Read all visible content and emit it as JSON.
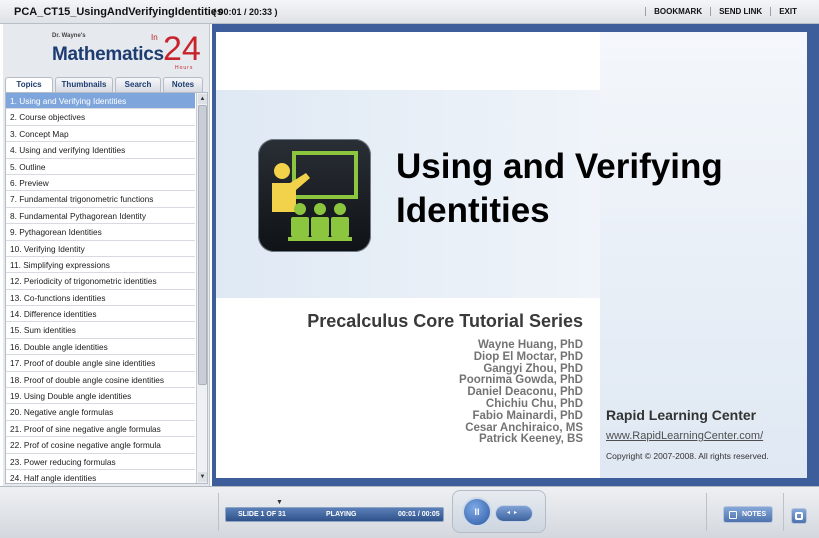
{
  "topbar": {
    "title": "PCA_CT15_UsingAndVerifyingIdentities",
    "time": "( 00:01 / 20:33 )",
    "links": [
      "BOOKMARK",
      "SEND LINK",
      "EXIT"
    ]
  },
  "logo": {
    "byline": "Dr. Wayne's",
    "name": "Mathematics",
    "prefix": "In",
    "number": "24",
    "suffix": "Hours"
  },
  "tabs": [
    "Topics",
    "Thumbnails",
    "Search",
    "Notes"
  ],
  "topics": [
    "1. Using and Verifying Identities",
    "2. Course objectives",
    "3. Concept Map",
    "4. Using and verifying Identities",
    "5. Outline",
    "6. Preview",
    "7. Fundamental trigonometric functions",
    "8.  Fundamental Pythagorean Identity",
    "9. Pythagorean Identities",
    "10. Verifying Identity",
    "11. Simplifying expressions",
    "12. Periodicity of trigonometric identities",
    "13. Co-functions identities",
    "14. Difference identities",
    "15. Sum identities",
    "16. Double angle identities",
    "17. Proof of double angle sine identities",
    "18. Proof of double angle cosine identities",
    "19. Using Double angle identities",
    "20. Negative angle formulas",
    "21. Proof of sine negative angle formulas",
    "22. Prof of cosine negative angle formula",
    "23. Power reducing formulas",
    "24. Half angle identities"
  ],
  "slide": {
    "title_line1": "Using and Verifying",
    "title_line2": "Identities",
    "series": "Precalculus Core Tutorial Series",
    "authors": [
      "Wayne Huang, PhD",
      "Diop El Moctar, PhD",
      "Gangyi Zhou, PhD",
      "Poornima Gowda, PhD",
      "Daniel Deaconu, PhD",
      "Chichiu Chu, PhD",
      "Fabio Mainardi, PhD",
      "Cesar Anchiraico,  MS",
      "Patrick Keeney,  BS"
    ],
    "company": "Rapid Learning Center",
    "url": "www.RapidLearningCenter.com/",
    "copyright": "Copyright © 2007-2008. All rights reserved."
  },
  "player": {
    "slide_counter": "SLIDE 1 OF 31",
    "status": "PLAYING",
    "elapsed": "00:01 / 00:05",
    "play_glyph": "II",
    "seek_glyph": "◂▸",
    "notes_label": "NOTES"
  },
  "colors": {
    "frame_blue": "#3d5e9a",
    "selected_row": "#7fa6dc",
    "logo_red": "#c8232c",
    "logo_blue": "#1d3d72"
  }
}
